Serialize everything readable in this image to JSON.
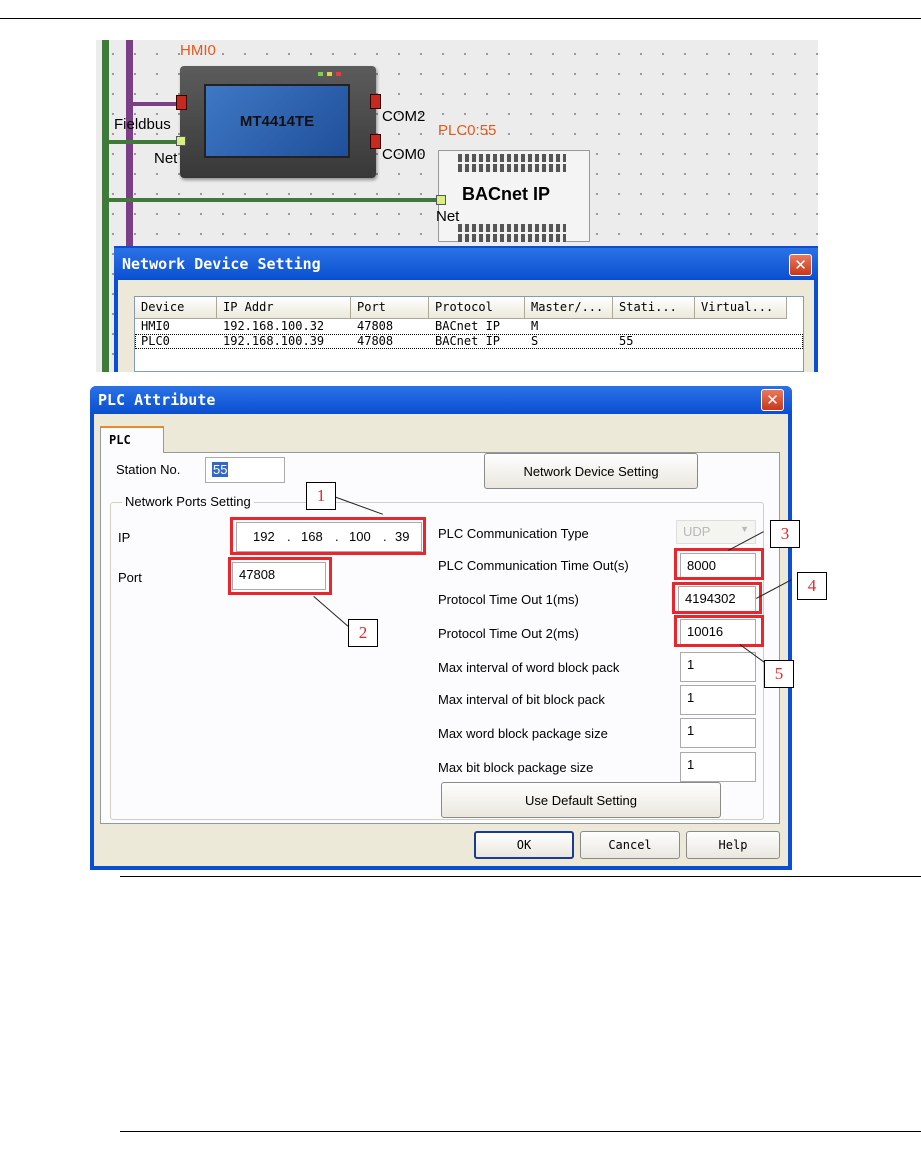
{
  "canvas": {
    "hmi_label": "HMI0",
    "hmi_model": "MT4414TE",
    "fieldbus_label": "Fieldbus",
    "net_label_hmi": "Net",
    "com2_label": "COM2",
    "com0_label": "COM0",
    "plc_label": "PLC0:55",
    "plc_title": "BACnet IP",
    "net_label_plc": "Net"
  },
  "network_device_setting": {
    "title": "Network Device Setting",
    "close": "✕",
    "columns": [
      "Device",
      "IP Addr",
      "Port",
      "Protocol",
      "Master/...",
      "Stati...",
      "Virtual..."
    ],
    "rows": [
      [
        "HMI0",
        "192.168.100.32",
        "47808",
        "BACnet IP",
        "M",
        "",
        ""
      ],
      [
        "PLC0",
        "192.168.100.39",
        "47808",
        "BACnet IP",
        "S",
        "55",
        ""
      ]
    ]
  },
  "plc_attribute": {
    "title": "PLC Attribute",
    "close": "✕",
    "tab_label": "PLC",
    "station_no_label": "Station No.",
    "station_no_value": "55",
    "network_device_setting_button": "Network Device Setting",
    "network_ports_group": "Network Ports Setting",
    "ip_label": "IP",
    "ip_value": [
      "192",
      "168",
      "100",
      "39"
    ],
    "ip_separator": ".",
    "port_label": "Port",
    "port_value": "47808",
    "comm_type_label": "PLC Communication Type",
    "comm_type_value": "UDP",
    "comm_timeout_label": "PLC Communication Time Out(s)",
    "comm_timeout_value": "8000",
    "protocol_timeout1_label": "Protocol Time Out 1(ms)",
    "protocol_timeout1_value": "4194302",
    "protocol_timeout2_label": "Protocol Time Out 2(ms)",
    "protocol_timeout2_value": "10016",
    "max_word_interval_label": "Max interval of word block pack",
    "max_word_interval_value": "1",
    "max_bit_interval_label": "Max interval of bit block pack",
    "max_bit_interval_value": "1",
    "max_word_size_label": "Max word block package size",
    "max_word_size_value": "1",
    "max_bit_size_label": "Max bit block package size",
    "max_bit_size_value": "1",
    "use_default_button": "Use Default Setting",
    "ok_button": "OK",
    "cancel_button": "Cancel",
    "help_button": "Help"
  },
  "callouts": [
    "1",
    "2",
    "3",
    "4",
    "5"
  ],
  "colors": {
    "title_bar": "#0a4fd0",
    "callout_red": "#e8262b",
    "dialog_bg": "#ece9d8",
    "bus_green": "#3f7a3a",
    "bus_purple": "#7a3f86"
  }
}
